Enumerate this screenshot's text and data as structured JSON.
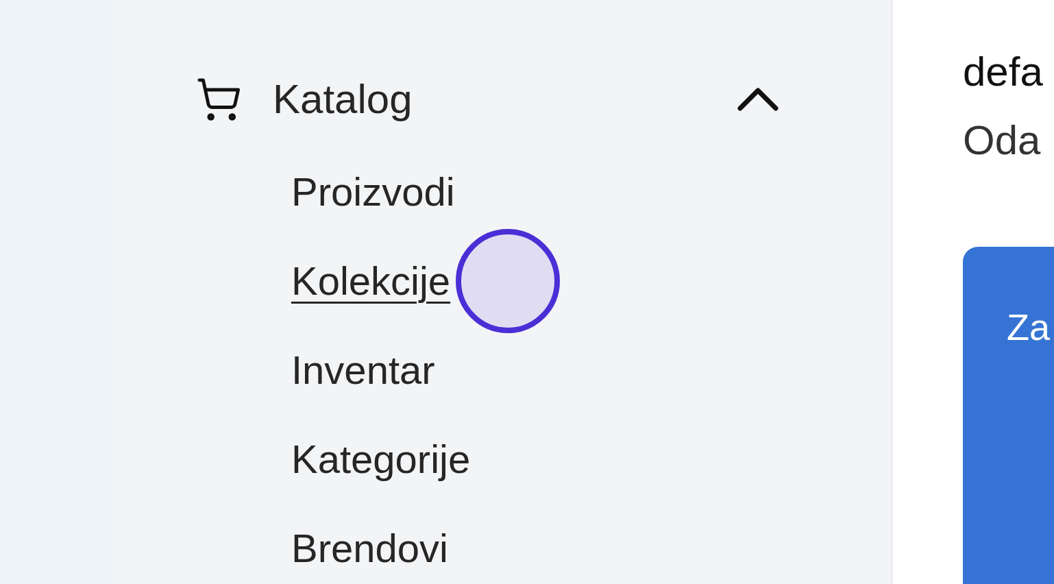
{
  "sidebar": {
    "items": [
      {
        "label": "Katalog",
        "expanded": true,
        "children": [
          {
            "label": "Proizvodi",
            "hovered": false
          },
          {
            "label": "Kolekcije",
            "hovered": true
          },
          {
            "label": "Inventar",
            "hovered": false
          },
          {
            "label": "Kategorije",
            "hovered": false
          },
          {
            "label": "Brendovi",
            "hovered": false
          }
        ]
      }
    ]
  },
  "main": {
    "title": "defa",
    "subtitle": "Oda",
    "card": {
      "title": "Za"
    }
  }
}
